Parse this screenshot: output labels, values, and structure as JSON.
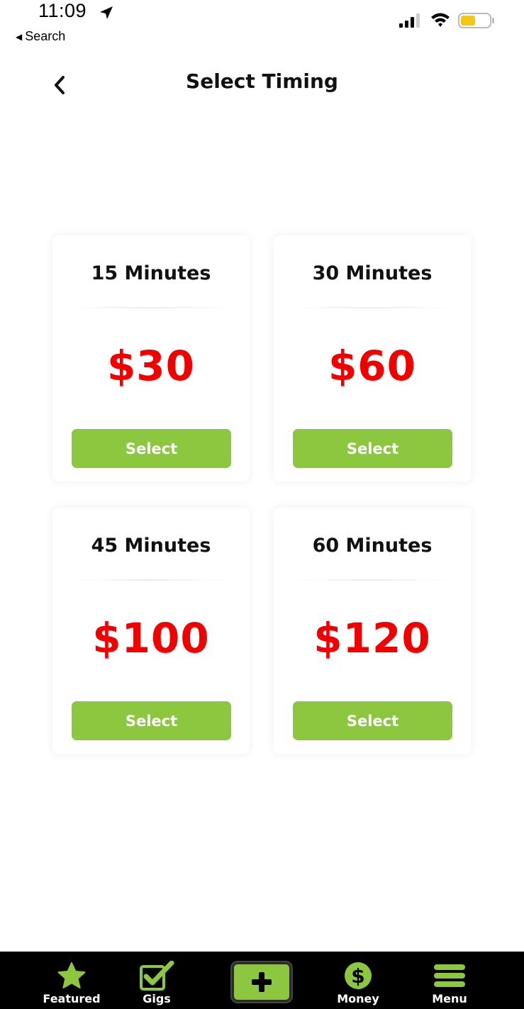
{
  "status_bar": {
    "time": "11:09",
    "back_label": "Search"
  },
  "header": {
    "title": "Select Timing"
  },
  "options": [
    {
      "duration": "15 Minutes",
      "price": "$30",
      "button_label": "Select"
    },
    {
      "duration": "30 Minutes",
      "price": "$60",
      "button_label": "Select"
    },
    {
      "duration": "45 Minutes",
      "price": "$100",
      "button_label": "Select"
    },
    {
      "duration": "60 Minutes",
      "price": "$120",
      "button_label": "Select"
    }
  ],
  "bottom_nav": {
    "items": [
      {
        "label": "Featured",
        "icon": "star-icon"
      },
      {
        "label": "Gigs",
        "icon": "checkbox-icon"
      },
      {
        "label": "",
        "icon": "plus-icon"
      },
      {
        "label": "Money",
        "icon": "dollar-circle-icon"
      },
      {
        "label": "Menu",
        "icon": "hamburger-menu-icon"
      }
    ]
  },
  "colors": {
    "accent_green": "#8dc63f",
    "price_red": "#f20000",
    "nav_background": "#000000"
  }
}
